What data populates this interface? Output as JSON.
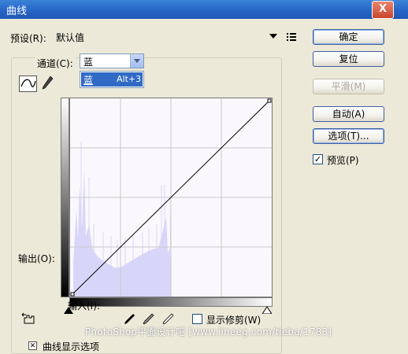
{
  "window": {
    "title": "曲线",
    "close_glyph": "X"
  },
  "preset": {
    "label": "预设(R):",
    "value": "默认值"
  },
  "channel": {
    "label": "通道(C):",
    "value": "蓝",
    "dropdown_item_label": "蓝",
    "dropdown_item_shortcut": "Alt+3"
  },
  "graph": {
    "output_label": "输出(O):",
    "input_label": "输入(I):"
  },
  "buttons": {
    "ok": "确定",
    "reset": "复位",
    "smooth": "平滑(M)",
    "auto": "自动(A)",
    "options": "选项(T)..."
  },
  "preview": {
    "label": "预览(P)",
    "checked": true
  },
  "show_clipping": {
    "label": "显示修剪(W)",
    "checked": false
  },
  "curve_display_options": {
    "label": "曲线显示选项"
  },
  "watermark": "PhotoShop平面设计吧 [www.lineeg.com/tieba/1783]",
  "colors": {
    "titlebar": "#2563c4",
    "histogram": "#d8d6f8",
    "graph_bg": "#fbf8fd",
    "dropdown_highlight": "#316ac5"
  }
}
